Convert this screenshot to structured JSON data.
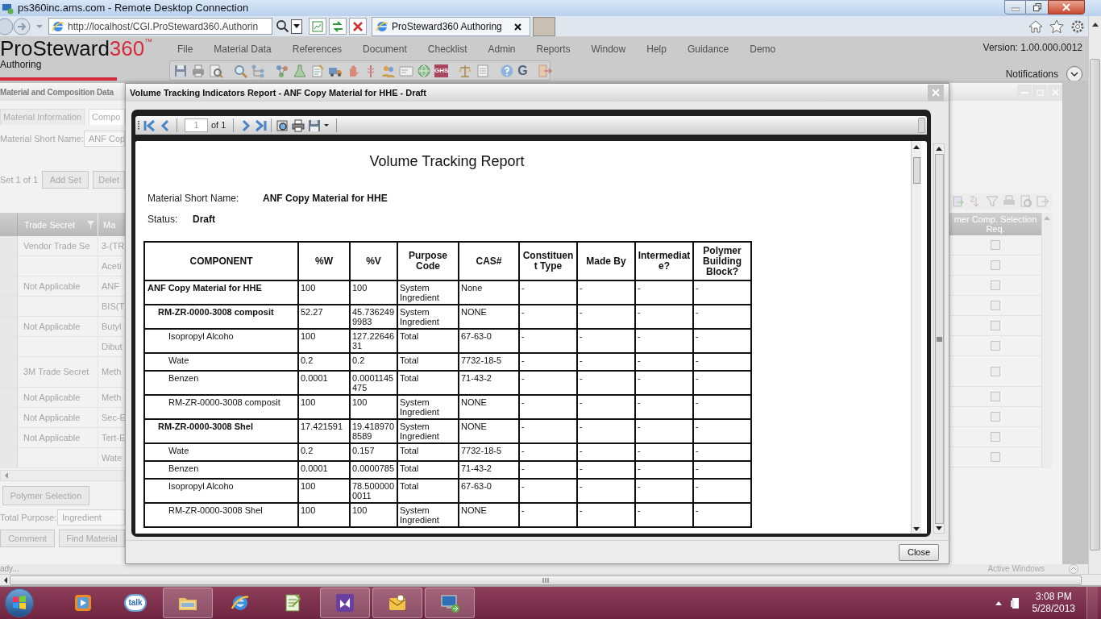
{
  "rdp_window": {
    "title": "ps360inc.ams.com - Remote Desktop Connection"
  },
  "browser": {
    "address": "http://localhost/CGI.ProSteward360.Authorin",
    "tabs": [
      {
        "label": "ProSteward360 Authoring",
        "selected": true
      }
    ]
  },
  "app": {
    "logo": {
      "name": "ProSteward",
      "number": "360",
      "mark": "™",
      "subtitle": "Authoring"
    },
    "menu": [
      "File",
      "Material Data",
      "References",
      "Document",
      "Checklist",
      "Admin",
      "Reports",
      "Window",
      "Help",
      "Guidance",
      "Demo"
    ],
    "toolbar": [
      {
        "kind": "save"
      },
      {
        "kind": "print"
      },
      {
        "kind": "preview"
      },
      {
        "kind": "separator"
      },
      {
        "kind": "search"
      },
      {
        "kind": "tree"
      },
      {
        "kind": "separator"
      },
      {
        "kind": "molecules"
      },
      {
        "kind": "flask"
      },
      {
        "kind": "document"
      },
      {
        "kind": "truck"
      },
      {
        "kind": "hand"
      },
      {
        "kind": "staff"
      },
      {
        "kind": "people"
      },
      {
        "kind": "card"
      },
      {
        "kind": "globe"
      },
      {
        "kind": "ghs",
        "label": "GHS"
      },
      {
        "kind": "separator"
      },
      {
        "kind": "scales"
      },
      {
        "kind": "page"
      },
      {
        "kind": "separator"
      },
      {
        "kind": "help"
      },
      {
        "kind": "letter",
        "label": "G"
      },
      {
        "kind": "separator"
      },
      {
        "kind": "exit"
      }
    ],
    "version": "Version: 1.00.000.0012",
    "notifications": "Notifications"
  },
  "background_window": {
    "title": "Material and Composition Data",
    "tabs": [
      {
        "label": "Material Information",
        "selected": false
      },
      {
        "label": "Compo",
        "selected": true
      }
    ],
    "short_name_label": "Material Short Name:",
    "short_name_value": "ANF Cop",
    "set_label": "Set 1 of 1",
    "set_buttons": [
      "Add Set",
      "Delet"
    ],
    "columns": [
      "Trade Secret",
      "Ma",
      "mer Comp. Selection Req."
    ],
    "rows": [
      {
        "trade_secret": "Vendor Trade Se",
        "material": "3-(TR",
        "checked": false
      },
      {
        "trade_secret": "",
        "material": "Aceti",
        "checked": false
      },
      {
        "trade_secret": "Not Applicable",
        "material": "ANF",
        "checked": false
      },
      {
        "trade_secret": "",
        "material": "BIS(T",
        "checked": false
      },
      {
        "trade_secret": "Not Applicable",
        "material": "Butyl",
        "checked": false
      },
      {
        "trade_secret": "",
        "material": "Dibut",
        "checked": false
      },
      {
        "trade_secret": "3M Trade Secret",
        "material": "Meth",
        "checked": false,
        "tall": true
      },
      {
        "trade_secret": "Not Applicable",
        "material": "Meth",
        "checked": false
      },
      {
        "trade_secret": "Not Applicable",
        "material": "Sec-E",
        "checked": false
      },
      {
        "trade_secret": "Not Applicable",
        "material": "Tert-E",
        "checked": false
      },
      {
        "trade_secret": "",
        "material": "Wate",
        "checked": false
      }
    ],
    "polymer_button": "Polymer Selection",
    "total_purpose_label": "Total Purpose:",
    "total_purpose_value": "Ingredient",
    "bottom_buttons": [
      "Comment",
      "Find Material"
    ]
  },
  "status_bar": {
    "text": "ady...",
    "active_windows": "Active Windows"
  },
  "report_dialog": {
    "title": "Volume Tracking Indicators Report - ANF Copy Material for HHE - Draft",
    "page": "1",
    "page_count": "of 1",
    "report": {
      "heading": "Volume Tracking Report",
      "fields": [
        {
          "label": "Material Short Name:",
          "value": "ANF Copy Material for HHE"
        },
        {
          "label": "Status:",
          "value": "Draft"
        }
      ],
      "columns": [
        "COMPONENT",
        "%W",
        "%V",
        "Purpose Code",
        "CAS#",
        "Constituent Type",
        "Made By",
        "Intermediate?",
        "Polymer Building Block?"
      ],
      "rows": [
        {
          "component": "ANF Copy Material for HHE",
          "w": "100",
          "v": "100",
          "purpose": "System Ingredient",
          "cas": "None",
          "constituent_type": "-",
          "made_by": "-",
          "intermediate": "-",
          "polymer_block": "-",
          "children": [
            {
              "component": "RM-ZR-0000-3008 composit",
              "w": "52.27",
              "v": "45.7362499983",
              "purpose": "System Ingredient",
              "cas": "NONE",
              "constituent_type": "-",
              "made_by": "-",
              "intermediate": "-",
              "polymer_block": "-",
              "children": [
                {
                  "component": "Isopropyl Alcoho",
                  "w": "100",
                  "v": "127.2264631",
                  "purpose": "Total",
                  "cas": "67-63-0",
                  "constituent_type": "-",
                  "made_by": "-",
                  "intermediate": "-",
                  "polymer_block": "-"
                },
                {
                  "component": "Wate",
                  "w": "0.2",
                  "v": "0.2",
                  "purpose": "Total",
                  "cas": "7732-18-5",
                  "constituent_type": "-",
                  "made_by": "-",
                  "intermediate": "-",
                  "polymer_block": "-"
                },
                {
                  "component": "Benzen",
                  "w": "0.0001",
                  "v": "0.0001145475",
                  "purpose": "Total",
                  "cas": "71-43-2",
                  "constituent_type": "-",
                  "made_by": "-",
                  "intermediate": "-",
                  "polymer_block": "-"
                },
                {
                  "component": "RM-ZR-0000-3008 composit",
                  "w": "100",
                  "v": "100",
                  "purpose": "System Ingredient",
                  "cas": "NONE",
                  "constituent_type": "-",
                  "made_by": "-",
                  "intermediate": "-",
                  "polymer_block": "-"
                }
              ]
            },
            {
              "component": "RM-ZR-0000-3008 Shel",
              "w": "17.421591",
              "v": "19.4189708589",
              "purpose": "System Ingredient",
              "cas": "NONE",
              "constituent_type": "-",
              "made_by": "-",
              "intermediate": "-",
              "polymer_block": "-",
              "children": [
                {
                  "component": "Wate",
                  "w": "0.2",
                  "v": "0.157",
                  "purpose": "Total",
                  "cas": "7732-18-5",
                  "constituent_type": "-",
                  "made_by": "-",
                  "intermediate": "-",
                  "polymer_block": "-"
                },
                {
                  "component": "Benzen",
                  "w": "0.0001",
                  "v": "0.0000785",
                  "purpose": "Total",
                  "cas": "71-43-2",
                  "constituent_type": "-",
                  "made_by": "-",
                  "intermediate": "-",
                  "polymer_block": "-"
                },
                {
                  "component": "Isopropyl Alcoho",
                  "w": "100",
                  "v": "78.5000000011",
                  "purpose": "Total",
                  "cas": "67-63-0",
                  "constituent_type": "-",
                  "made_by": "-",
                  "intermediate": "-",
                  "polymer_block": "-"
                },
                {
                  "component": "RM-ZR-0000-3008 Shel",
                  "w": "100",
                  "v": "100",
                  "purpose": "System Ingredient",
                  "cas": "NONE",
                  "constituent_type": "-",
                  "made_by": "-",
                  "intermediate": "-",
                  "polymer_block": "-"
                }
              ]
            }
          ]
        }
      ]
    },
    "close_button": "Close"
  },
  "taskbar": {
    "apps": [
      {
        "kind": "media-player",
        "running": false
      },
      {
        "kind": "talk",
        "label": "talk",
        "running": false
      },
      {
        "kind": "folder",
        "running": true
      },
      {
        "kind": "browser",
        "running": false
      },
      {
        "kind": "notepad",
        "running": false
      },
      {
        "kind": "visual-studio",
        "running": true
      },
      {
        "kind": "mail",
        "running": true
      },
      {
        "kind": "remote-desktop",
        "running": true
      }
    ],
    "time": "3:08 PM",
    "date": "5/28/2013"
  }
}
